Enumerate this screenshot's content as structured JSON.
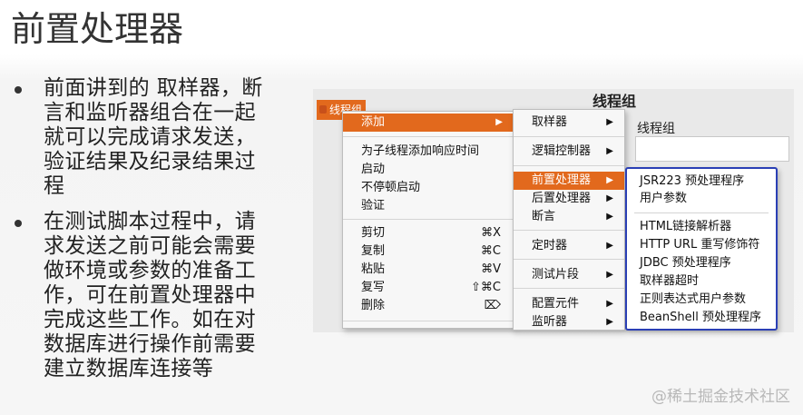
{
  "slide": {
    "title": "前置处理器",
    "bullets": [
      [
        "前面讲到的 取样器，断",
        "言和监听器组合在一起",
        "就可以完成请求发送，",
        "验证结果及纪录结果过",
        "程"
      ],
      [
        "在测试脚本过程中，请",
        "求发送之前可能会需要",
        "做环境或参数的准备工",
        "作，可在前置处理器中",
        "完成这些工作。如在对",
        "数据库进行操作前需要",
        "建立数据库连接等"
      ]
    ]
  },
  "app": {
    "tree_node": "线程组",
    "panel_heading": "线程组",
    "panel_label": "线程组"
  },
  "context_menu": {
    "add": "添加",
    "add_think_time": "为子线程添加响应时间",
    "start": "启动",
    "start_no_pause": "不停顿启动",
    "validate": "验证",
    "cut": "剪切",
    "cut_shortcut": "⌘X",
    "copy": "复制",
    "copy_shortcut": "⌘C",
    "paste": "粘贴",
    "paste_shortcut": "⌘V",
    "duplicate": "复写",
    "duplicate_shortcut": "⇧⌘C",
    "remove": "删除",
    "remove_shortcut": "⌦"
  },
  "add_menu": {
    "sampler": "取样器",
    "logic_controller": "逻辑控制器",
    "pre_processors": "前置处理器",
    "post_processors": "后置处理器",
    "assertions": "断言",
    "timer": "定时器",
    "test_fragment": "测试片段",
    "config_element": "配置元件",
    "listener": "监听器"
  },
  "preprocessor_menu": {
    "items": [
      "JSR223 预处理程序",
      "用户参数",
      "HTML链接解析器",
      "HTTP URL 重写修饰符",
      "JDBC 预处理程序",
      "取样器超时",
      "正则表达式用户参数",
      "BeanShell 预处理程序"
    ]
  },
  "watermark": "@稀土掘金技术社区",
  "colors": {
    "menu_highlight": "#e2691d",
    "submenu_border": "#2a3fb5"
  }
}
